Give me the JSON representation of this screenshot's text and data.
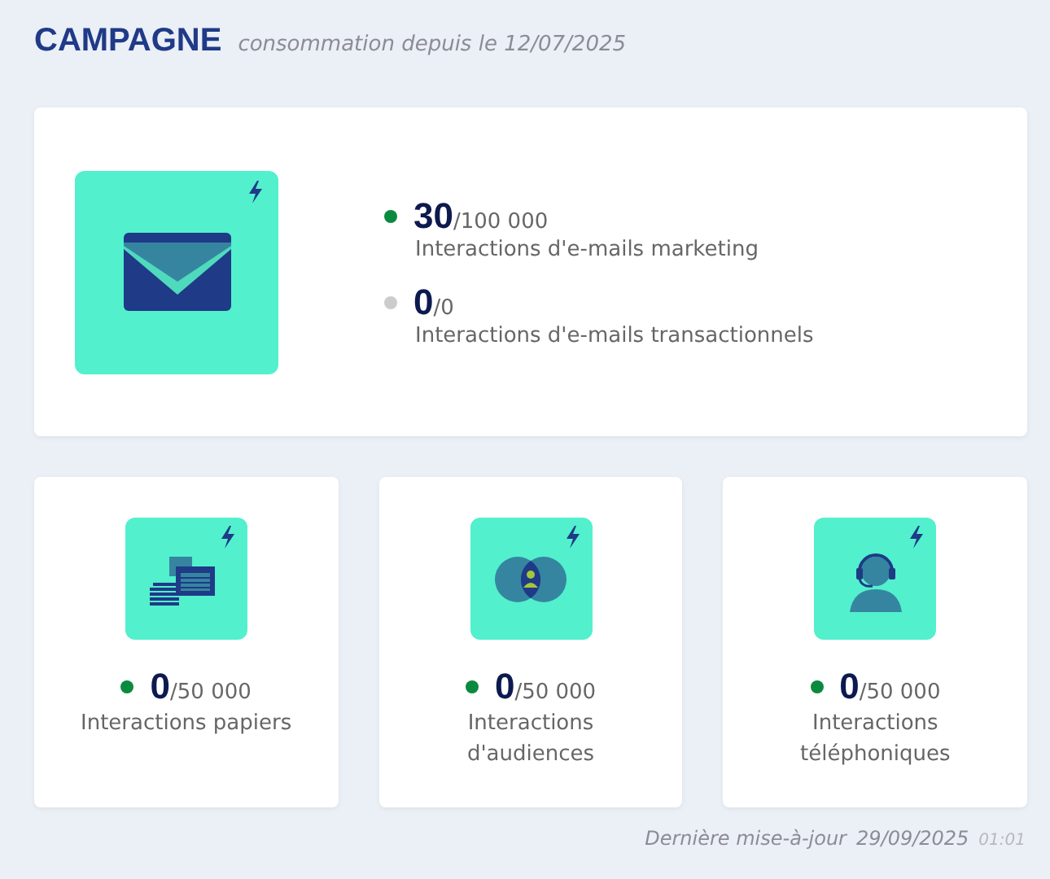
{
  "header": {
    "title": "CAMPAGNE",
    "subtitle": "consommation depuis le 12/07/2025"
  },
  "main_card": {
    "kind": "email",
    "stats": [
      {
        "value": "30",
        "limit": "/100 000",
        "label": "Interactions d'e-mails marketing",
        "color": "#0a8a3e"
      },
      {
        "value": "0",
        "limit": "/0",
        "label": "Interactions d'e-mails transactionnels",
        "color": "#cccccc"
      }
    ]
  },
  "cards": [
    {
      "kind": "paper",
      "value": "0",
      "limit": "/50 000",
      "label": "Interactions papiers",
      "color": "#0a8a3e"
    },
    {
      "kind": "audience",
      "value": "0",
      "limit": "/50 000",
      "label": "Interactions d'audiences",
      "color": "#0a8a3e"
    },
    {
      "kind": "phone",
      "value": "0",
      "limit": "/50 000",
      "label": "Interactions téléphoniques",
      "color": "#0a8a3e"
    }
  ],
  "footer": {
    "label": "Dernière mise-à-jour",
    "date": "29/09/2025",
    "time": "01:01"
  }
}
